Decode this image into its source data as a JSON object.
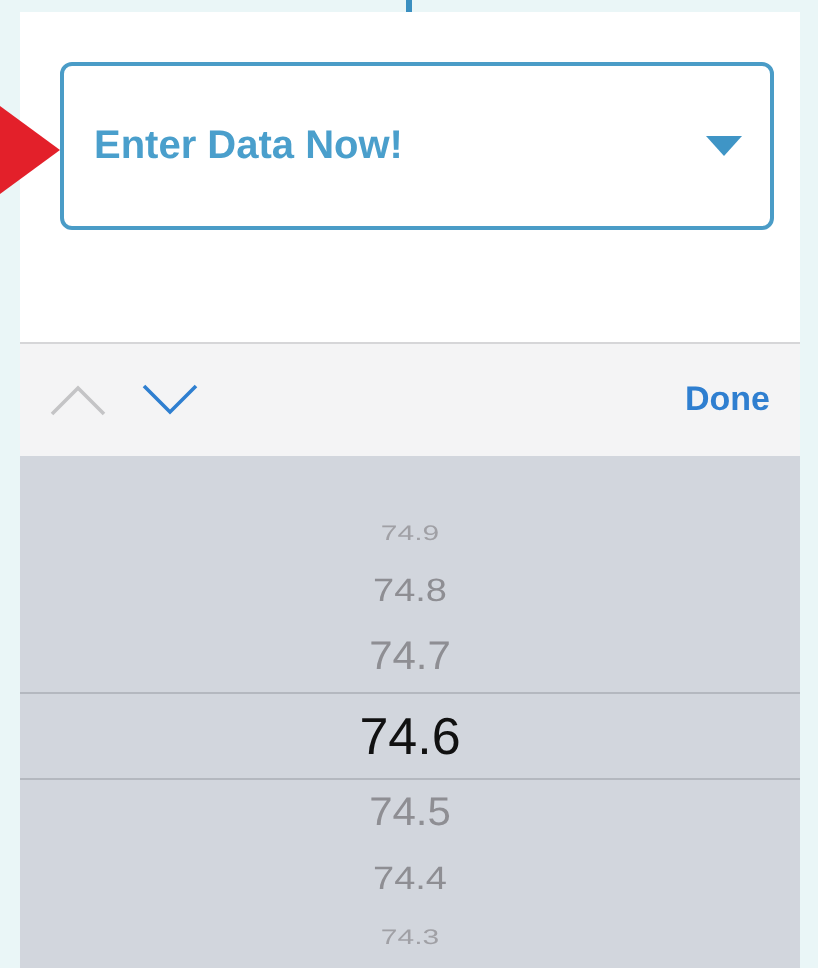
{
  "dropdown": {
    "value": "Enter Data Now!"
  },
  "toolbar": {
    "previous": {
      "disabled": true
    },
    "next": {
      "disabled": false
    },
    "done": "Done"
  },
  "picker": {
    "options": [
      {
        "label": "74.9",
        "selected": false
      },
      {
        "label": "74.8",
        "selected": false
      },
      {
        "label": "74.7",
        "selected": false
      },
      {
        "label": "74.6",
        "selected": true
      },
      {
        "label": "74.5",
        "selected": false
      },
      {
        "label": "74.4",
        "selected": false
      },
      {
        "label": "74.3",
        "selected": false
      }
    ]
  }
}
